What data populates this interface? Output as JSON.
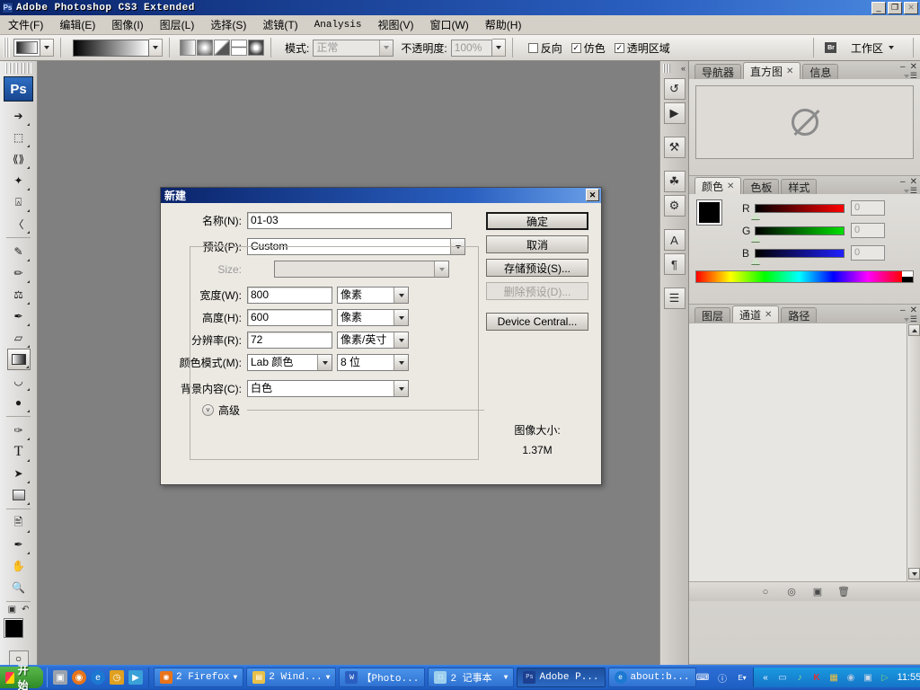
{
  "window": {
    "app_badge": "Ps",
    "title": "Adobe Photoshop CS3 Extended",
    "minimize": "_",
    "restore": "❐",
    "close": "✕"
  },
  "menubar": {
    "items": [
      {
        "label": "文件(F)"
      },
      {
        "label": "编辑(E)"
      },
      {
        "label": "图像(I)"
      },
      {
        "label": "图层(L)"
      },
      {
        "label": "选择(S)"
      },
      {
        "label": "滤镜(T)"
      },
      {
        "label": "Analysis"
      },
      {
        "label": "视图(V)"
      },
      {
        "label": "窗口(W)"
      },
      {
        "label": "帮助(H)"
      }
    ]
  },
  "options_bar": {
    "mode_label": "模式:",
    "mode_value": "正常",
    "opacity_label": "不透明度:",
    "opacity_value": "100%",
    "reverse_label": "反向",
    "reverse_checked": false,
    "dither_label": "仿色",
    "dither_checked": true,
    "transparency_label": "透明区域",
    "transparency_checked": true,
    "bridge_icon": "Br",
    "workspace_label": "工作区",
    "gradient_types": [
      "linear-gradient",
      "radial-gradient",
      "angle-gradient",
      "reflected-gradient",
      "diamond-gradient"
    ]
  },
  "toolbox": {
    "logo": "Ps",
    "tools": [
      {
        "name": "move-tool",
        "glyph": "↖"
      },
      {
        "name": "marquee-tool",
        "glyph": "⬚"
      },
      {
        "name": "lasso-tool",
        "glyph": "❀"
      },
      {
        "name": "magic-wand-tool",
        "glyph": "✳"
      },
      {
        "name": "crop-tool",
        "glyph": "⛏"
      },
      {
        "name": "slice-tool",
        "glyph": "✂"
      },
      {
        "name": "healing-brush-tool",
        "glyph": "✎"
      },
      {
        "name": "brush-tool",
        "glyph": "✏"
      },
      {
        "name": "clone-stamp-tool",
        "glyph": "⚲"
      },
      {
        "name": "history-brush-tool",
        "glyph": "✒"
      },
      {
        "name": "eraser-tool",
        "glyph": "▱"
      },
      {
        "name": "gradient-tool",
        "glyph": "▤",
        "active": true
      },
      {
        "name": "blur-tool",
        "glyph": "●"
      },
      {
        "name": "dodge-tool",
        "glyph": "⚲"
      },
      {
        "name": "pen-tool",
        "glyph": "✑"
      },
      {
        "name": "type-tool",
        "glyph": "T"
      },
      {
        "name": "path-selection-tool",
        "glyph": "➤"
      },
      {
        "name": "shape-tool",
        "glyph": "■"
      },
      {
        "name": "notes-tool",
        "glyph": "☰"
      },
      {
        "name": "eyedropper-tool",
        "glyph": "✒"
      },
      {
        "name": "hand-tool",
        "glyph": "✋"
      },
      {
        "name": "zoom-tool",
        "glyph": "⚲"
      }
    ],
    "foreground_color": "#000000",
    "background_color": "#ffffff"
  },
  "dock_strip": {
    "icons": [
      {
        "name": "history-icon",
        "glyph": "↺"
      },
      {
        "name": "actions-icon",
        "glyph": "▶"
      },
      {
        "name": "tool-presets-icon",
        "glyph": "⚒"
      },
      {
        "name": "brushes-icon",
        "glyph": "☘"
      },
      {
        "name": "clone-source-icon",
        "glyph": "⚙"
      },
      {
        "name": "character-icon",
        "glyph": "A"
      },
      {
        "name": "paragraph-icon",
        "glyph": "¶"
      },
      {
        "name": "layer-comps-icon",
        "glyph": "☰"
      }
    ]
  },
  "panels": {
    "navigator_group": {
      "tabs": [
        {
          "label": "导航器",
          "active": false,
          "closable": false
        },
        {
          "label": "直方图",
          "active": true,
          "closable": true
        },
        {
          "label": "信息",
          "active": false,
          "closable": false
        }
      ]
    },
    "color_group": {
      "tabs": [
        {
          "label": "颜色",
          "active": true,
          "closable": true
        },
        {
          "label": "色板",
          "active": false,
          "closable": false
        },
        {
          "label": "样式",
          "active": false,
          "closable": false
        }
      ],
      "channels": [
        {
          "label": "R",
          "value": "0"
        },
        {
          "label": "G",
          "value": "0"
        },
        {
          "label": "B",
          "value": "0"
        }
      ]
    },
    "layers_group": {
      "tabs": [
        {
          "label": "图层",
          "active": false,
          "closable": false
        },
        {
          "label": "通道",
          "active": true,
          "closable": true
        },
        {
          "label": "路径",
          "active": false,
          "closable": false
        }
      ],
      "footer_icons": [
        {
          "name": "load-channel-selection-icon",
          "glyph": "○"
        },
        {
          "name": "save-selection-as-channel-icon",
          "glyph": "◎"
        },
        {
          "name": "create-new-channel-icon",
          "glyph": "◳"
        },
        {
          "name": "delete-channel-icon",
          "glyph": "⌧"
        }
      ]
    }
  },
  "dialog": {
    "title": "新建",
    "close_label": "✕",
    "name_label": "名称(N):",
    "name_value": "01-03",
    "preset_label": "预设(P):",
    "preset_value": "Custom",
    "size_label": "Size:",
    "size_value": "",
    "width_label": "宽度(W):",
    "width_value": "800",
    "width_unit": "像素",
    "height_label": "高度(H):",
    "height_value": "600",
    "height_unit": "像素",
    "resolution_label": "分辨率(R):",
    "resolution_value": "72",
    "resolution_unit": "像素/英寸",
    "colormode_label": "颜色模式(M):",
    "colormode_value": "Lab 颜色",
    "bitdepth_value": "8 位",
    "background_label": "背景内容(C):",
    "background_value": "白色",
    "advanced_label": "高级",
    "advanced_arrow": "˅",
    "buttons": {
      "ok": "确定",
      "cancel": "取消",
      "save_preset": "存储预设(S)...",
      "delete_preset": "删除预设(D)...",
      "device_central": "Device Central..."
    },
    "image_size_label": "图像大小:",
    "image_size_value": "1.37M"
  },
  "taskbar": {
    "start_label": "开始",
    "quick_launch": [
      {
        "name": "show-desktop-icon",
        "glyph": "▣",
        "color": "#9aa3ad"
      },
      {
        "name": "firefox-icon",
        "glyph": "◉",
        "color": "#e8741a"
      },
      {
        "name": "internet-explorer-icon",
        "glyph": "e",
        "color": "#1c78d0"
      },
      {
        "name": "clock-icon",
        "glyph": "◷",
        "color": "#e0a020"
      },
      {
        "name": "media-icon",
        "glyph": "▶",
        "color": "#3aa0d8"
      }
    ],
    "tasks": [
      {
        "label": "2 Firefox",
        "icon_glyph": "◉",
        "icon_color": "#e8741a",
        "has_arrow": true,
        "active": false
      },
      {
        "label": "2 Wind...",
        "icon_glyph": "▤",
        "icon_color": "#e8c04a",
        "has_arrow": true,
        "active": false
      },
      {
        "label": "【Photo...",
        "icon_glyph": "W",
        "icon_color": "#2a5fc0",
        "has_arrow": false,
        "active": false
      },
      {
        "label": "2 记事本",
        "icon_glyph": "□",
        "icon_color": "#9ed0ee",
        "has_arrow": true,
        "active": false
      },
      {
        "label": "Adobe P...",
        "icon_glyph": "Ps",
        "icon_color": "#1c3f8f",
        "has_arrow": false,
        "active": true
      },
      {
        "label": "about:b...",
        "icon_glyph": "e",
        "icon_color": "#1c78d0",
        "has_arrow": false,
        "active": false
      }
    ],
    "tray_left": [
      {
        "name": "keyboard-icon",
        "glyph": "⌨"
      },
      {
        "name": "help-icon",
        "glyph": "?"
      },
      {
        "name": "ime-icon",
        "glyph": "E"
      }
    ],
    "tray": [
      {
        "name": "show-hidden-icons-icon",
        "glyph": "«"
      },
      {
        "name": "network-icon",
        "glyph": "▥",
        "color": "#cfe6ff"
      },
      {
        "name": "sound-icon",
        "glyph": "♪",
        "color": "#8ce08c"
      },
      {
        "name": "antivirus-icon",
        "glyph": "K",
        "color": "#e03030"
      },
      {
        "name": "monitor-icon",
        "glyph": "▦",
        "color": "#f0c040"
      },
      {
        "name": "updates-icon",
        "glyph": "●",
        "color": "#b0c8e0"
      },
      {
        "name": "network-connection-icon",
        "glyph": "☷",
        "color": "#c8d8e8"
      },
      {
        "name": "media-player-icon",
        "glyph": "▷",
        "color": "#7ad07a"
      }
    ],
    "clock": "11:55"
  }
}
